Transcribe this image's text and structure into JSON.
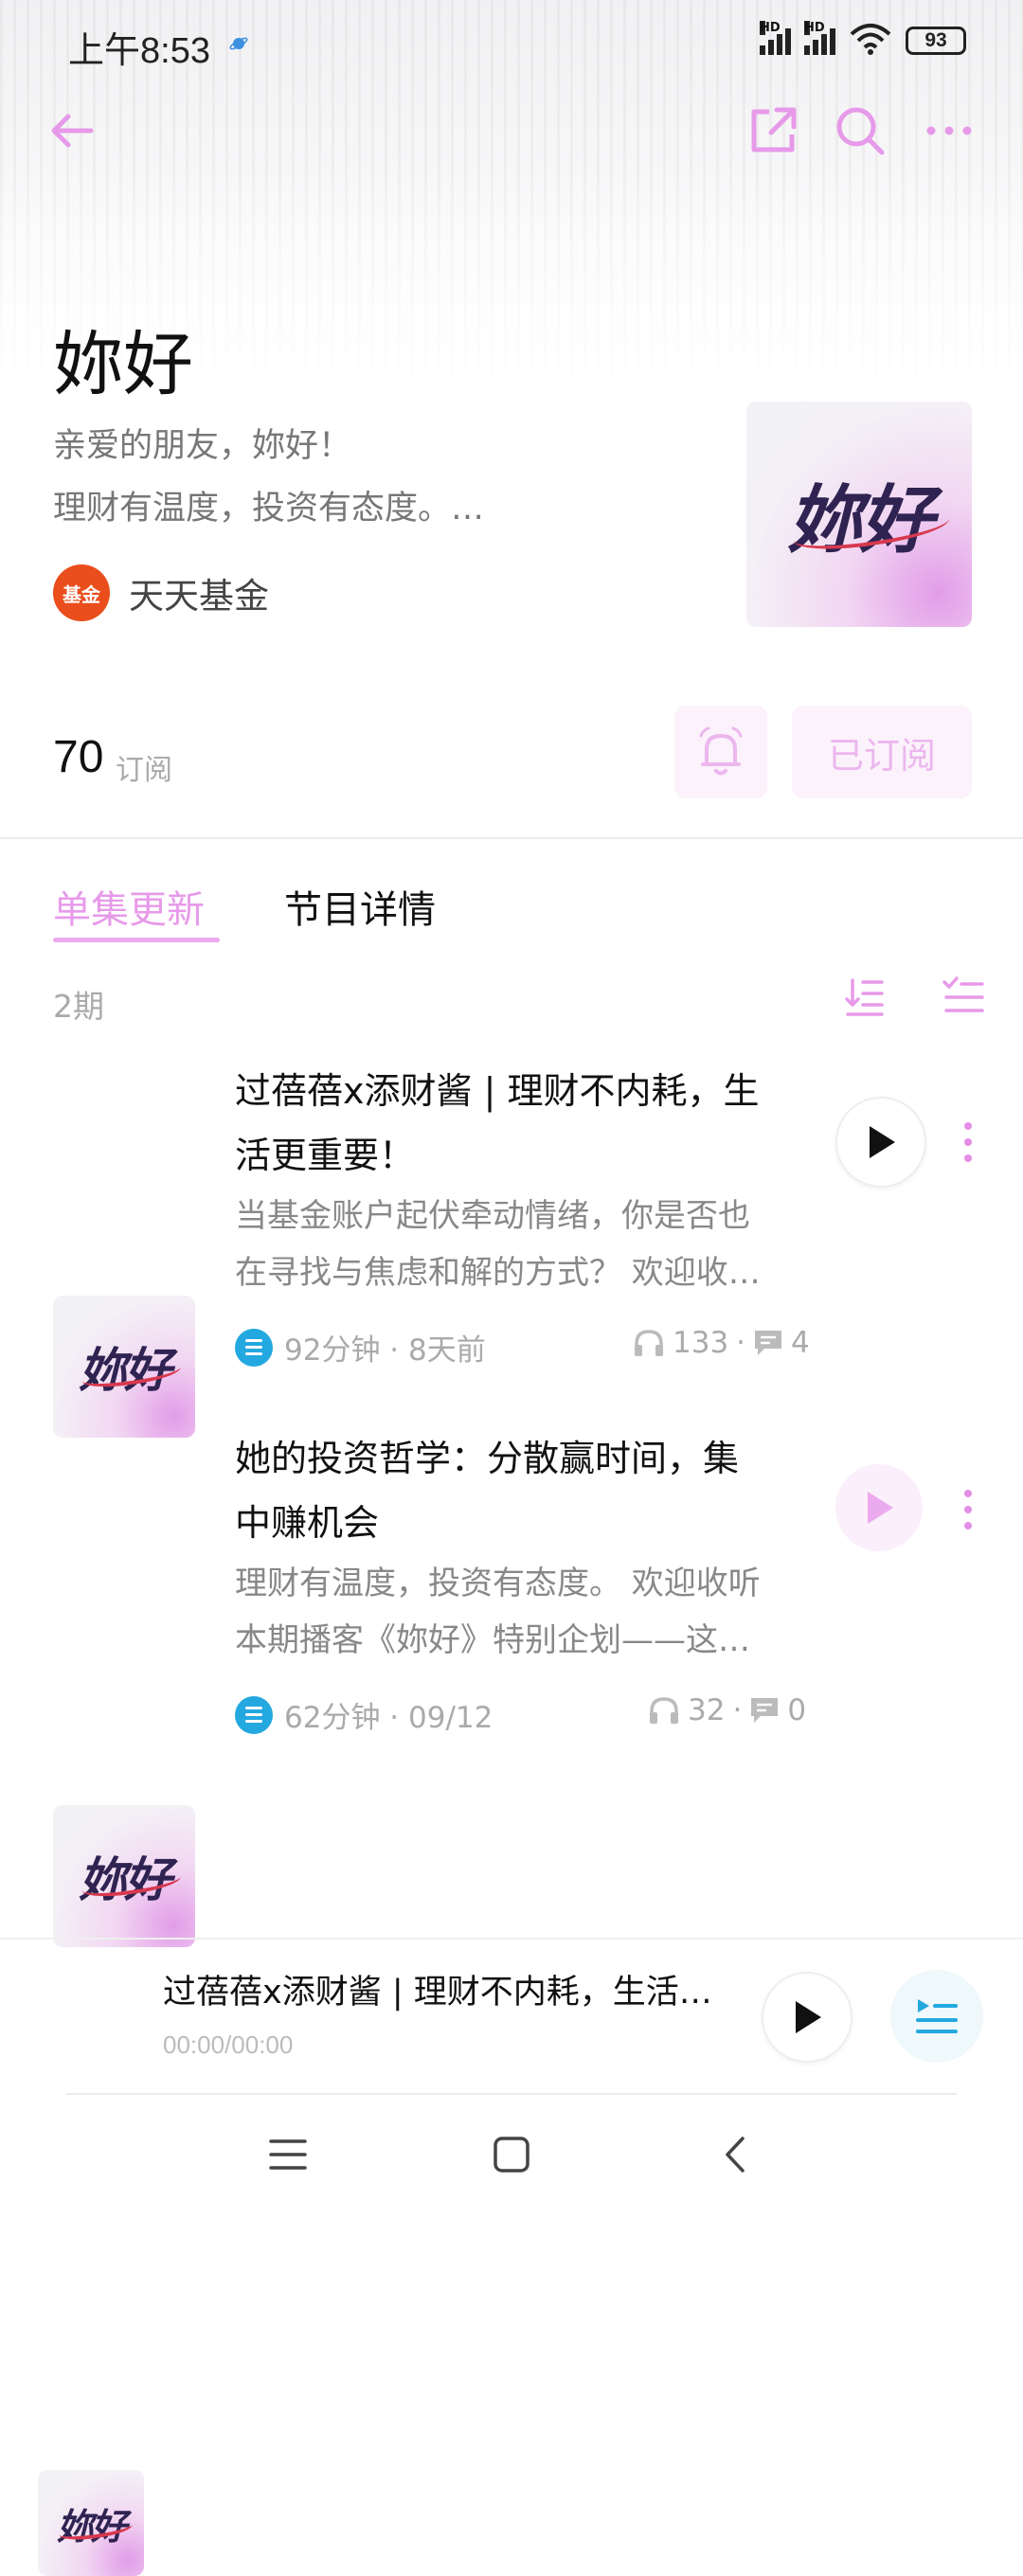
{
  "status_bar": {
    "time": "上午8:53",
    "battery": "93",
    "signal_label": "HD"
  },
  "nav": {
    "back_icon": "arrow-left-icon",
    "share_icon": "share-external-icon",
    "search_icon": "search-icon",
    "more_icon": "more-horizontal-icon"
  },
  "podcast": {
    "title": "妳好",
    "description_line1": "亲爱的朋友，妳好！",
    "description_line2": "理财有温度，投资有态度。…",
    "author_avatar_text": "基金",
    "author": "天天基金",
    "cover_text": "妳好",
    "subscriber_count": "70",
    "subscriber_label": "订阅",
    "subscribed_button": "已订阅"
  },
  "tabs": [
    {
      "label": "单集更新",
      "active": true
    },
    {
      "label": "节目详情",
      "active": false
    }
  ],
  "episode_count": "2期",
  "episodes": [
    {
      "title_line1": "过蓓蓓x添财酱 | 理财不内耗，生",
      "title_line2": "活更重要！",
      "desc_line1": "当基金账户起伏牵动情绪，你是否也",
      "desc_line2": "在寻找与焦虑和解的方式？ 欢迎收…",
      "meta": "92分钟 · 8天前",
      "listens": "133",
      "comments": "4",
      "cover_text": "妳好"
    },
    {
      "title_line1": "她的投资哲学：分散赢时间，集",
      "title_line2": "中赚机会",
      "desc_line1": "理财有温度，投资有态度。 欢迎收听",
      "desc_line2": "本期播客《妳好》特别企划——这…",
      "meta": "62分钟 · 09/12",
      "listens": "32",
      "comments": "0",
      "cover_text": "妳好"
    }
  ],
  "mini_player": {
    "title": "过蓓蓓x添财酱 | 理财不内耗，生活…",
    "time": "00:00/00:00",
    "cover_text": "妳好"
  },
  "colors": {
    "accent": "#e79ae9",
    "accent_light": "#fbf2fb",
    "badge_blue": "#24a8e0",
    "author_orange": "#ea4e1c"
  }
}
